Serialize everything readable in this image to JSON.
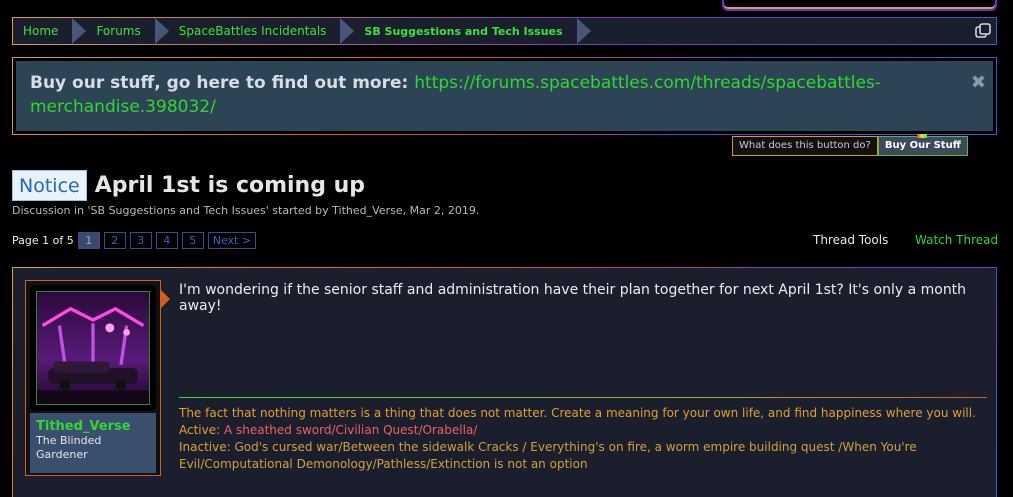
{
  "breadcrumb": {
    "items": [
      "Home",
      "Forums",
      "SpaceBattles Incidentals",
      "SB Suggestions and Tech Issues"
    ]
  },
  "notice": {
    "text": "Buy our stuff, go here to find out more: ",
    "link": "https://forums.spacebattles.com/threads/spacebattles-merchandise.398032/"
  },
  "buttons": {
    "what": "What does this button do?",
    "buy": "Buy Our Stuff"
  },
  "thread": {
    "prefix": "Notice",
    "title": "April 1st is coming up",
    "byline": "Discussion in 'SB Suggestions and Tech Issues' started by Tithed_Verse, Mar 2, 2019."
  },
  "pager": {
    "label": "Page 1 of 5",
    "pages": [
      "1",
      "2",
      "3",
      "4",
      "5"
    ],
    "next": "Next >"
  },
  "tools": {
    "thread_tools": "Thread Tools",
    "watch_thread": "Watch Thread"
  },
  "post": {
    "username": "Tithed_Verse",
    "usertitle": "The Blinded Gardener",
    "body": "I'm wondering if the senior staff and administration have their plan together for next April 1st? It's only a month away!",
    "signature": {
      "line1": "The fact that nothing matters is a thing that does not matter. Create a meaning for your own life, and find happiness where you will.",
      "active_label": "Active: ",
      "active": "A sheathed sword/Civilian Quest/Orabella/",
      "inactive_label": "Inactive: ",
      "inactive": "God's cursed war/Between the sidewalk Cracks / Everything's on fire, a worm empire building quest /When You're Evil/Computational Demonology/Pathless/Extinction is not an option"
    }
  }
}
